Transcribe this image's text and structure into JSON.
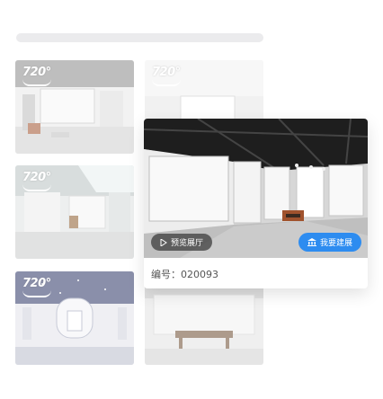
{
  "badge": "720°",
  "card": {
    "preview_label": "预览展厅",
    "build_label": "我要建展",
    "serial_label": "编号：",
    "serial_value": "020093"
  },
  "colors": {
    "accent": "#2d8cf0",
    "search_bar": "#ebebed"
  }
}
